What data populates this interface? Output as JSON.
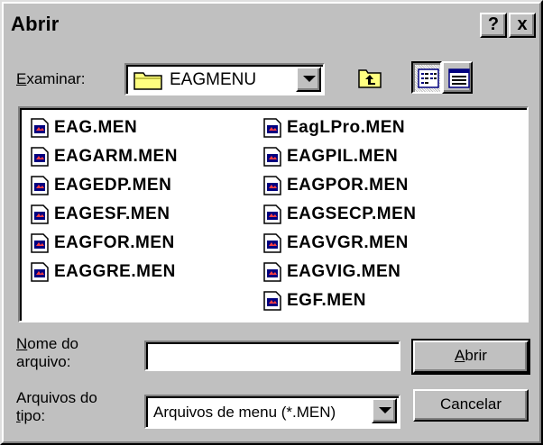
{
  "window": {
    "title": "Abrir",
    "help_label": "?",
    "close_label": "x"
  },
  "lookin": {
    "label_key": "E",
    "label_rest": "xaminar:",
    "value": "EAGMENU",
    "icon": "folder-icon"
  },
  "toolbar": {
    "up_icon": "up-one-level-icon",
    "list_icon": "list-view-icon",
    "details_icon": "details-view-icon"
  },
  "files": {
    "column1": [
      "EAG.MEN",
      "EAGARM.MEN",
      "EAGEDP.MEN",
      "EAGESF.MEN",
      "EAGFOR.MEN",
      "EAGGRE.MEN"
    ],
    "column2": [
      "EagLPro.MEN",
      "EAGPIL.MEN",
      "EAGPOR.MEN",
      "EAGSECP.MEN",
      "EAGVGR.MEN",
      "EAGVIG.MEN",
      "EGF.MEN"
    ]
  },
  "filename": {
    "label_key": "N",
    "label_line1_rest": "ome do",
    "label_line2": "arquivo:",
    "value": ""
  },
  "filetype": {
    "label_line1": "Arquivos do",
    "label_key": "t",
    "label_line2_rest": "ipo:",
    "value": "Arquivos de menu (*.MEN)"
  },
  "buttons": {
    "open_key": "A",
    "open_rest": "brir",
    "cancel": "Cancelar"
  },
  "colors": {
    "face": "#c0c0c0",
    "shadow": "#808080",
    "highlight": "#ffffff",
    "dark": "#000000",
    "folder": "#ffff80"
  }
}
